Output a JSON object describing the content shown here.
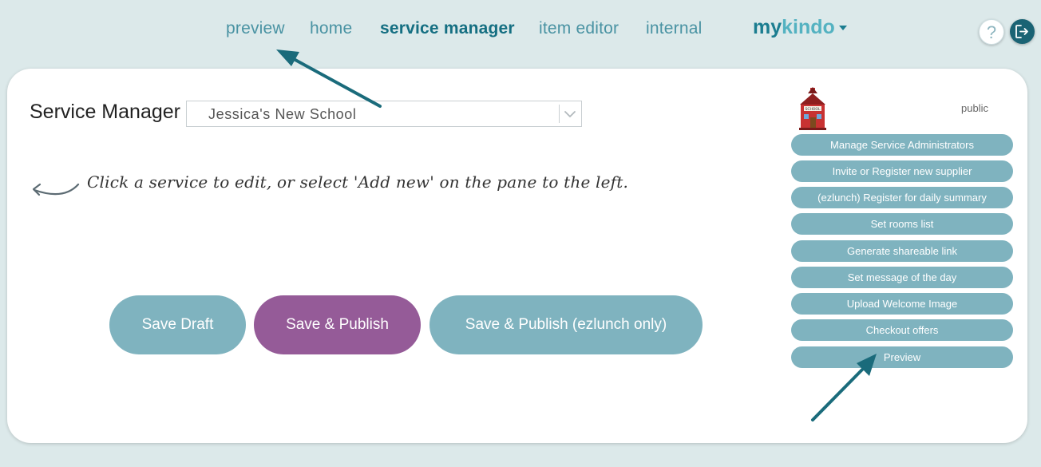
{
  "nav": {
    "links": [
      {
        "label": "preview",
        "active": false
      },
      {
        "label": "home",
        "active": false
      },
      {
        "label": "service manager",
        "active": true
      },
      {
        "label": "item editor",
        "active": false
      },
      {
        "label": "internal",
        "active": false
      }
    ],
    "brand": {
      "part1": "my",
      "part2": "kindo",
      "icon": "caret-down-icon"
    },
    "help_label": "?",
    "help_icon": "help-icon",
    "logout_icon": "logout-icon"
  },
  "main": {
    "title": "Service Manager",
    "school_select": {
      "value": "Jessica's New School",
      "icon": "chevron-down-icon"
    },
    "hint": "Click a service to edit, or select 'Add new' on the pane to the left.",
    "buttons": {
      "save_draft": "Save Draft",
      "save_publish": "Save & Publish",
      "save_publish_ezlunch": "Save & Publish (ezlunch only)"
    }
  },
  "side": {
    "school_icon": "school-building-icon",
    "visibility": "public",
    "buttons": [
      "Manage Service Administrators",
      "Invite or Register new supplier",
      "(ezlunch) Register for daily summary",
      "Set rooms list",
      "Generate shareable link",
      "Set message of the day",
      "Upload Welcome Image",
      "Checkout offers",
      "Preview"
    ]
  },
  "colors": {
    "background": "#dce9ea",
    "nav_text": "#4a93a3",
    "nav_active": "#156f82",
    "teal_button": "#7fb3bf",
    "purple_button": "#955b98",
    "annotation_arrow": "#1a6b7b"
  }
}
